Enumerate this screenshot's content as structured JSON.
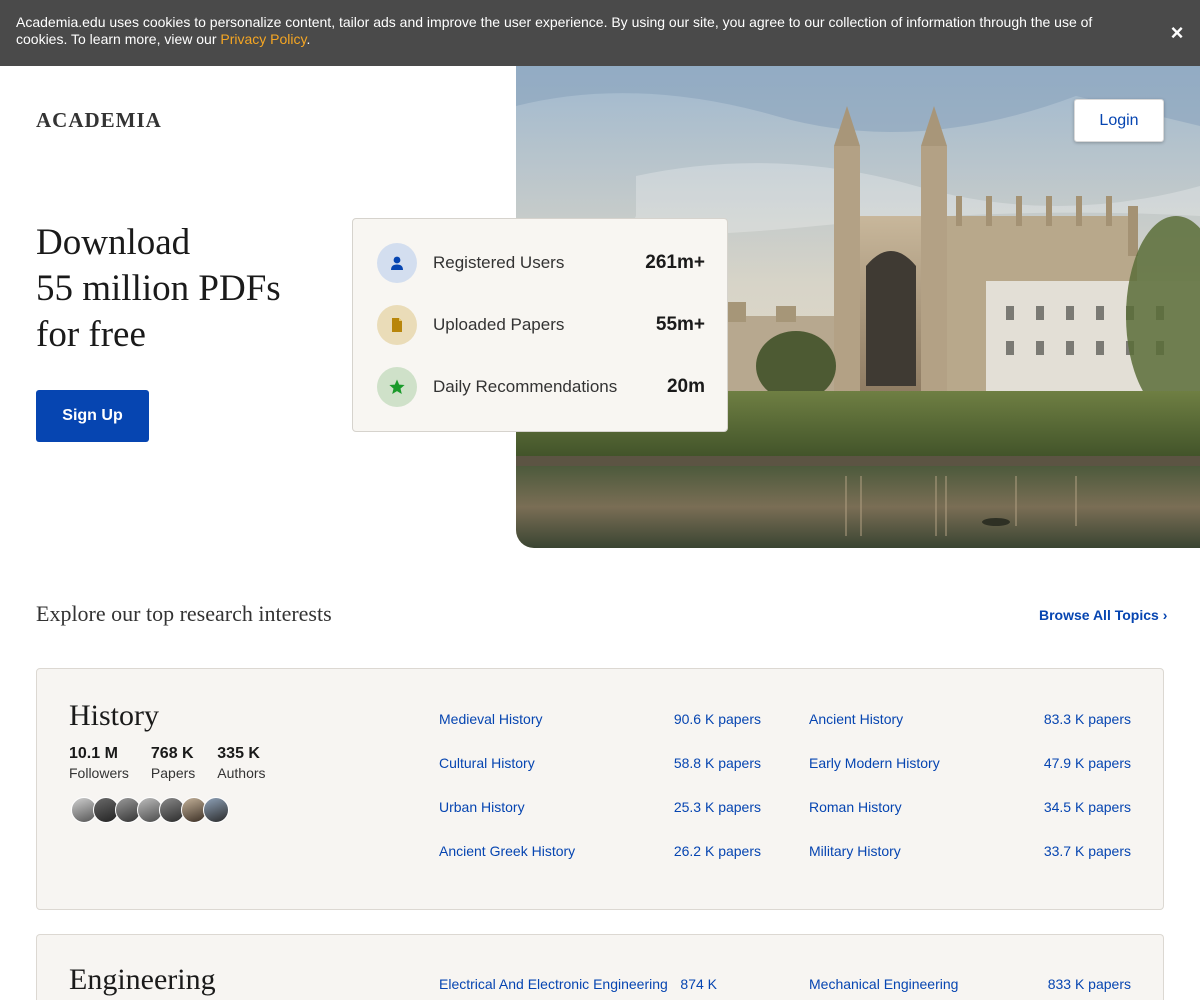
{
  "cookie": {
    "text": "Academia.edu uses cookies to personalize content, tailor ads and improve the user experience. By using our site, you agree to our collection of information through the use of cookies. To learn more, view our ",
    "link": "Privacy Policy",
    "suffix": ".",
    "close": "×"
  },
  "header": {
    "logo": "ACADEMIA",
    "login": "Login"
  },
  "hero": {
    "title_line1": "Download",
    "title_line2": "55 million PDFs",
    "title_line3": "for free",
    "signup": "Sign Up"
  },
  "stats": [
    {
      "label": "Registered Users",
      "value": "261m+",
      "icon": "user-icon",
      "color": "#d3deef"
    },
    {
      "label": "Uploaded Papers",
      "value": "55m+",
      "icon": "document-icon",
      "color": "#eadcb8"
    },
    {
      "label": "Daily Recommendations",
      "value": "20m",
      "icon": "star-icon",
      "color": "#cfe1c9"
    }
  ],
  "explore": {
    "title": "Explore our top research interests",
    "browse": "Browse All Topics ›"
  },
  "topics": [
    {
      "name": "History",
      "followers": "10.1 M",
      "followers_label": "Followers",
      "papers": "768 K",
      "papers_label": "Papers",
      "authors": "335 K",
      "authors_label": "Authors",
      "subtopics": [
        {
          "name": "Medieval History",
          "count": "90.6 K papers"
        },
        {
          "name": "Ancient History",
          "count": "83.3 K papers"
        },
        {
          "name": "Cultural History",
          "count": "58.8 K papers"
        },
        {
          "name": "Early Modern History",
          "count": "47.9 K papers"
        },
        {
          "name": "Urban History",
          "count": "25.3 K papers"
        },
        {
          "name": "Roman History",
          "count": "34.5 K papers"
        },
        {
          "name": "Ancient Greek History",
          "count": "26.2 K papers"
        },
        {
          "name": "Military History",
          "count": "33.7 K papers"
        }
      ]
    },
    {
      "name": "Engineering",
      "subtopics": [
        {
          "name": "Electrical And Electronic Engineering",
          "count": "874 K"
        },
        {
          "name": "Mechanical Engineering",
          "count": "833 K papers"
        }
      ]
    }
  ],
  "colors": {
    "brand": "#0645b1",
    "banner": "#4a4a4a",
    "link_accent": "#f5a623"
  }
}
